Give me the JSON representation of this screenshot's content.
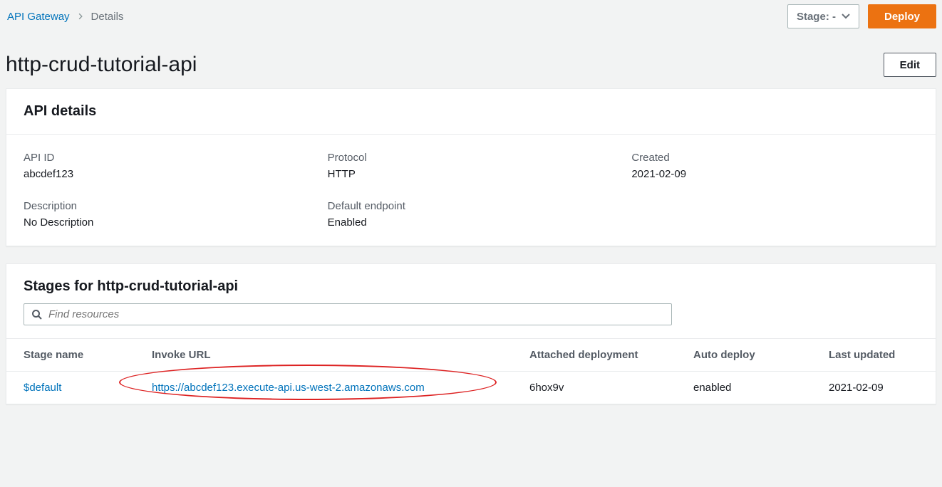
{
  "breadcrumb": {
    "root": "API Gateway",
    "current": "Details"
  },
  "top": {
    "stage_label": "Stage: -",
    "deploy_label": "Deploy"
  },
  "page": {
    "title": "http-crud-tutorial-api",
    "edit_label": "Edit"
  },
  "details": {
    "title": "API details",
    "api_id_label": "API ID",
    "api_id_value": "abcdef123",
    "protocol_label": "Protocol",
    "protocol_value": "HTTP",
    "created_label": "Created",
    "created_value": "2021-02-09",
    "description_label": "Description",
    "description_value": "No Description",
    "default_endpoint_label": "Default endpoint",
    "default_endpoint_value": "Enabled"
  },
  "stages": {
    "title": "Stages for http-crud-tutorial-api",
    "search_placeholder": "Find resources",
    "columns": {
      "stage_name": "Stage name",
      "invoke_url": "Invoke URL",
      "attached_deployment": "Attached deployment",
      "auto_deploy": "Auto deploy",
      "last_updated": "Last updated"
    },
    "rows": [
      {
        "stage_name": "$default",
        "invoke_url": "https://abcdef123.execute-api.us-west-2.amazonaws.com",
        "attached_deployment": "6hox9v",
        "auto_deploy": "enabled",
        "last_updated": "2021-02-09"
      }
    ]
  }
}
